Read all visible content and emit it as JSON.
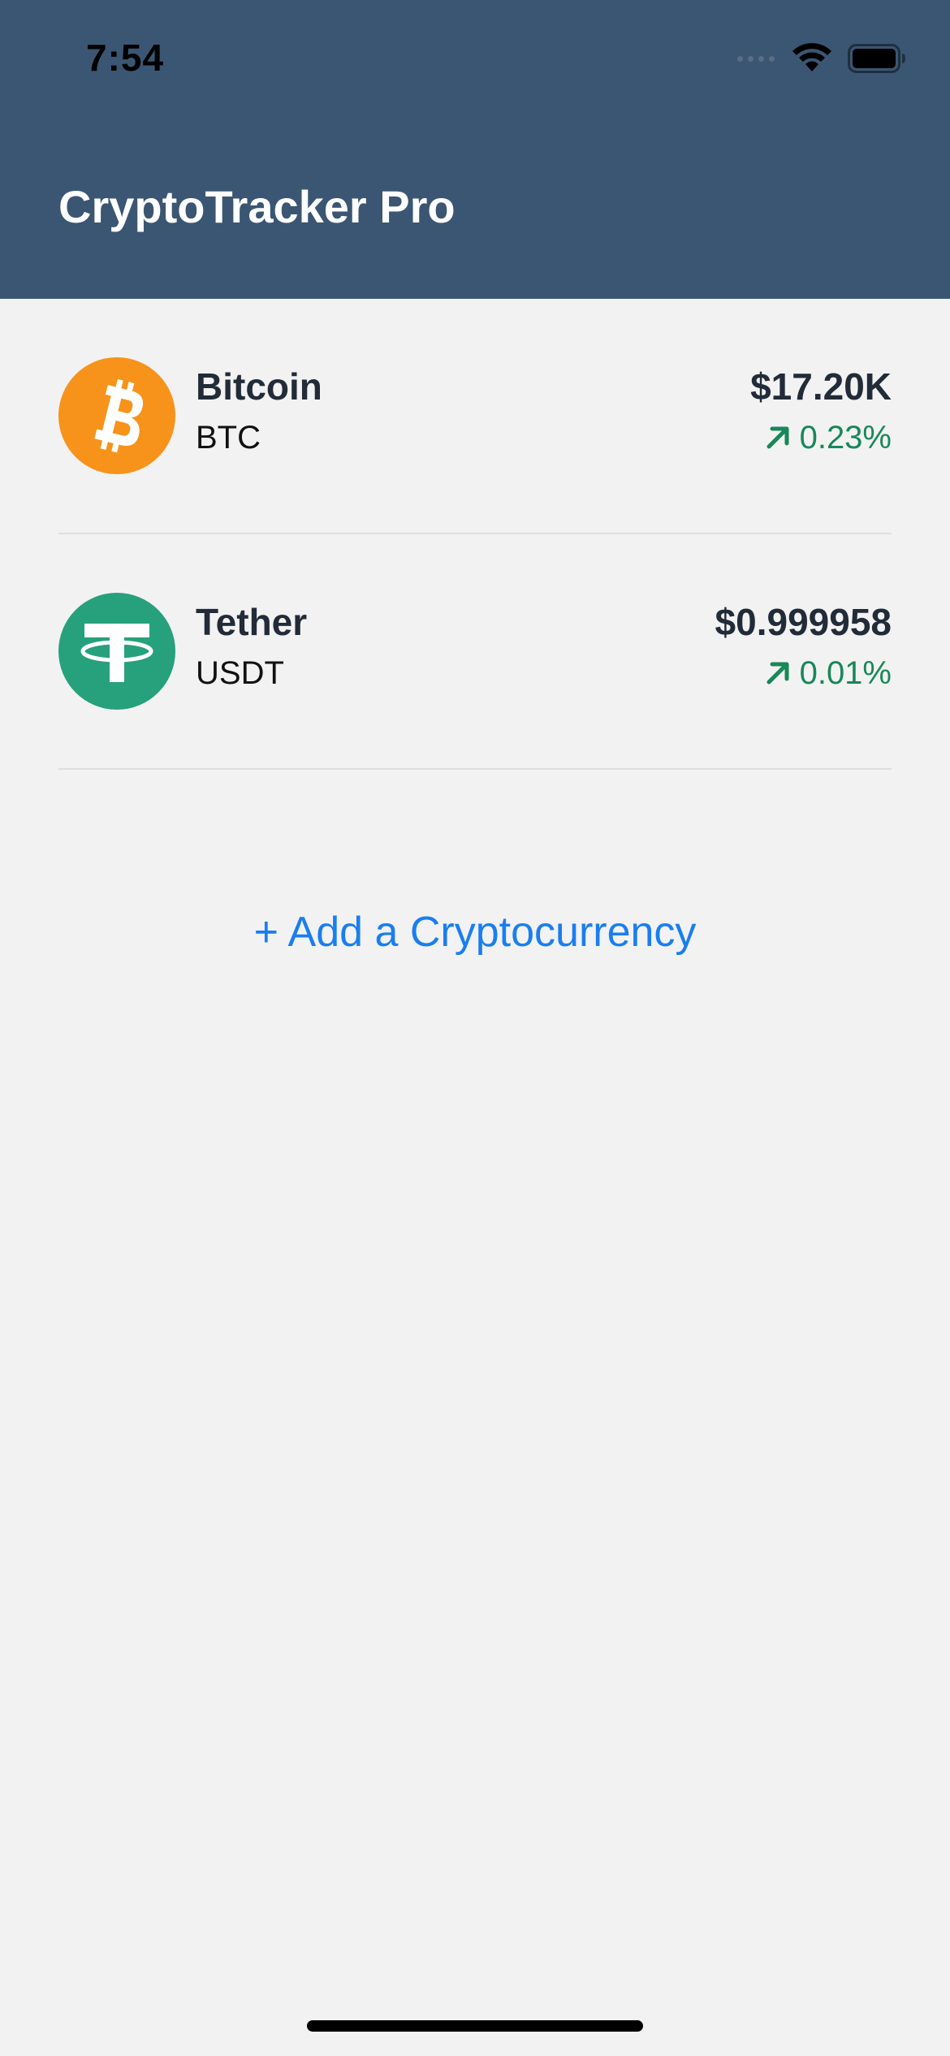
{
  "status_bar": {
    "time": "7:54",
    "icons": [
      "cellular-signal-icon",
      "wifi-icon",
      "battery-icon"
    ]
  },
  "header": {
    "title": "CryptoTracker Pro",
    "background_color": "#3a5673"
  },
  "coins": [
    {
      "name": "Bitcoin",
      "symbol": "BTC",
      "price": "$17.20K",
      "change": "0.23%",
      "change_direction": "up",
      "icon": "bitcoin-logo-icon",
      "logo_color": "#f7931a"
    },
    {
      "name": "Tether",
      "symbol": "USDT",
      "price": "$0.999958",
      "change": "0.01%",
      "change_direction": "up",
      "icon": "tether-logo-icon",
      "logo_color": "#26a17b"
    }
  ],
  "add_button": {
    "label": "+ Add a Cryptocurrency",
    "color": "#1a7ef0"
  },
  "colors": {
    "positive_change": "#18875a",
    "background": "#f2f2f2"
  }
}
